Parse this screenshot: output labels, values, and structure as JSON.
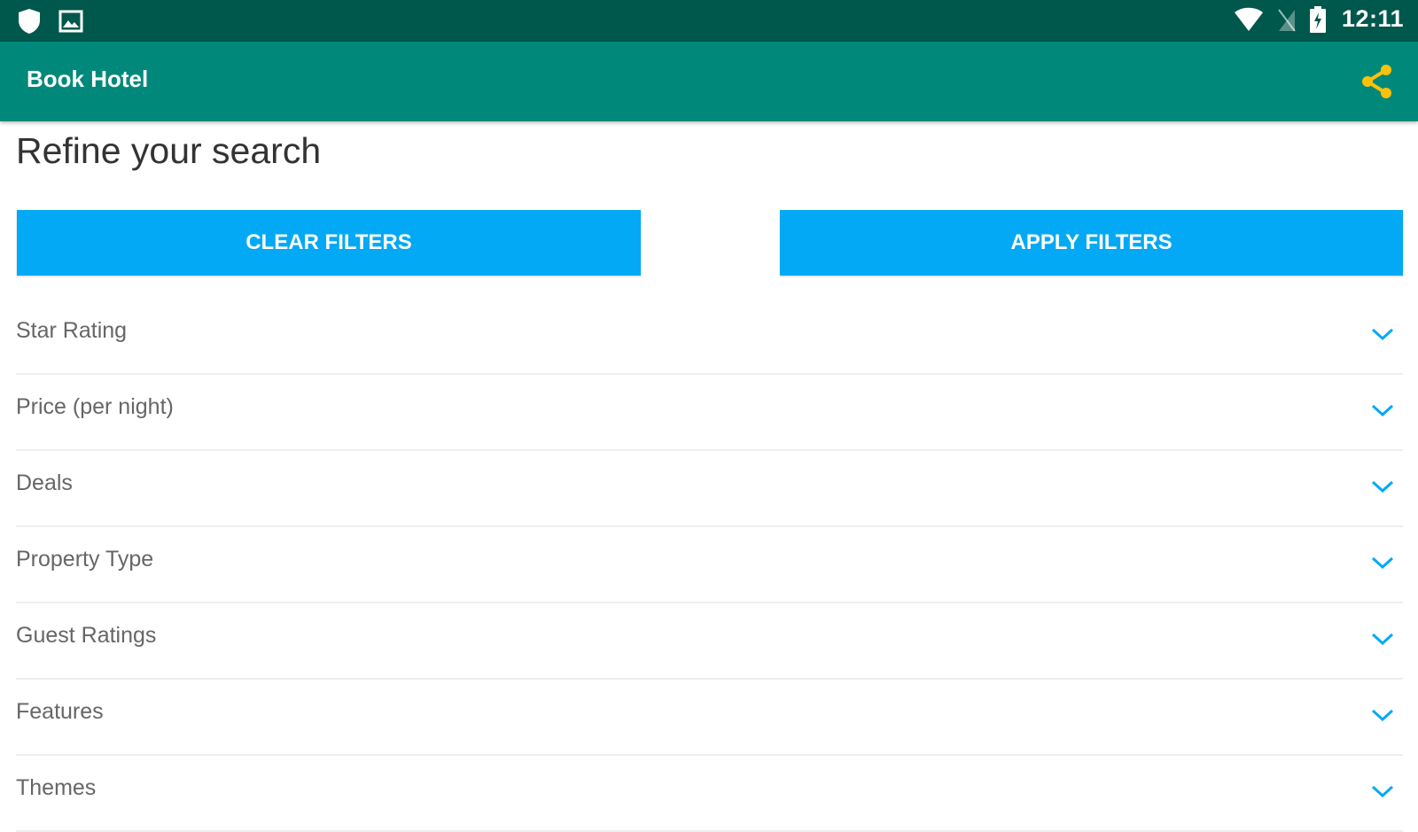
{
  "status_bar": {
    "icons": [
      "shield-icon",
      "image-icon",
      "wifi-icon",
      "no-sim-icon",
      "battery-charging-icon"
    ],
    "time": "12:11"
  },
  "app_bar": {
    "title": "Book Hotel",
    "share_icon": "share-icon",
    "background": "#00897b",
    "accent": "#ffc107"
  },
  "page": {
    "heading": "Refine your search",
    "clear_button": "CLEAR FILTERS",
    "apply_button": "APPLY FILTERS",
    "button_color": "#03a9f4"
  },
  "filters": [
    {
      "label": "Star Rating"
    },
    {
      "label": "Price (per night)"
    },
    {
      "label": "Deals"
    },
    {
      "label": "Property Type"
    },
    {
      "label": "Guest Ratings"
    },
    {
      "label": "Features"
    },
    {
      "label": "Themes"
    }
  ]
}
